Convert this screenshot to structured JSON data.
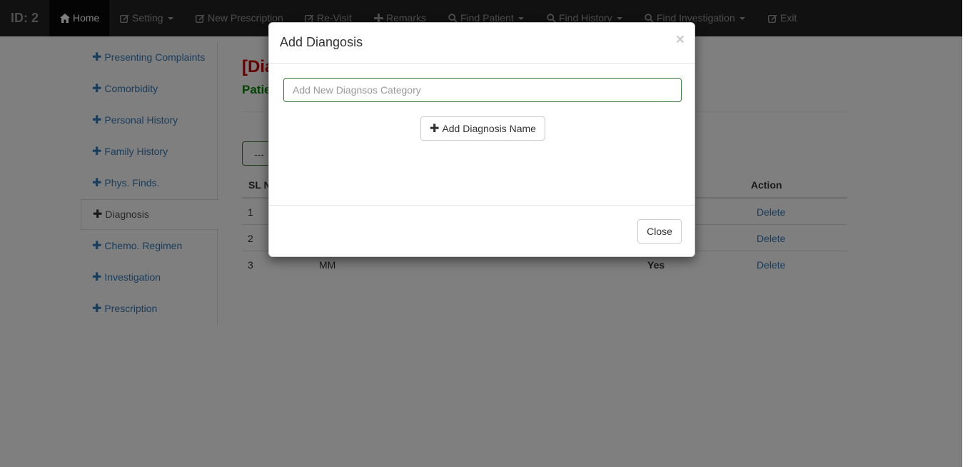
{
  "navbar": {
    "brand": "ID: 2",
    "items": [
      {
        "label": "Home",
        "icon": "home-icon"
      },
      {
        "label": "Setting",
        "icon": "edit-icon"
      },
      {
        "label": "New Prescription",
        "icon": "edit-icon"
      },
      {
        "label": "Re-Visit",
        "icon": "edit-icon"
      },
      {
        "label": "Remarks",
        "icon": "plus-icon"
      },
      {
        "label": "Find Patient",
        "icon": "search-icon"
      },
      {
        "label": "Find History",
        "icon": "search-icon"
      },
      {
        "label": "Find Investigation",
        "icon": "search-icon"
      },
      {
        "label": "Exit",
        "icon": "edit-icon"
      }
    ]
  },
  "sidebar": {
    "items": [
      {
        "label": "Presenting Complaints"
      },
      {
        "label": "Comorbidity"
      },
      {
        "label": "Personal History"
      },
      {
        "label": "Family History"
      },
      {
        "label": "Phys. Finds."
      },
      {
        "label": "Diagnosis"
      },
      {
        "label": "Chemo. Regimen"
      },
      {
        "label": "Investigation"
      },
      {
        "label": "Prescription"
      }
    ],
    "plus_glyph": "✚"
  },
  "main": {
    "title": "[Dia",
    "subtitle": "Patie",
    "select_value": "---",
    "table": {
      "headers": {
        "sl": "SL N",
        "action": "Action"
      },
      "rows": [
        {
          "sl": "1",
          "name": "",
          "flag": "",
          "action": "Delete"
        },
        {
          "sl": "2",
          "name": "",
          "flag": "",
          "action": "Delete"
        },
        {
          "sl": "3",
          "name": "MM",
          "flag": "Yes",
          "action": "Delete"
        }
      ]
    }
  },
  "modal": {
    "title": "Add Diangosis",
    "close_x": "×",
    "input_placeholder": "Add New Diagnsos Category",
    "input_value": "",
    "add_button": "Add Diagnosis Name",
    "add_glyph": "✚",
    "close_button": "Close"
  },
  "colors": {
    "navbar_bg": "#222222",
    "link": "#337ab7",
    "title_red": "#cc0000",
    "subtitle_green": "#008800",
    "input_border": "#3c763d"
  }
}
